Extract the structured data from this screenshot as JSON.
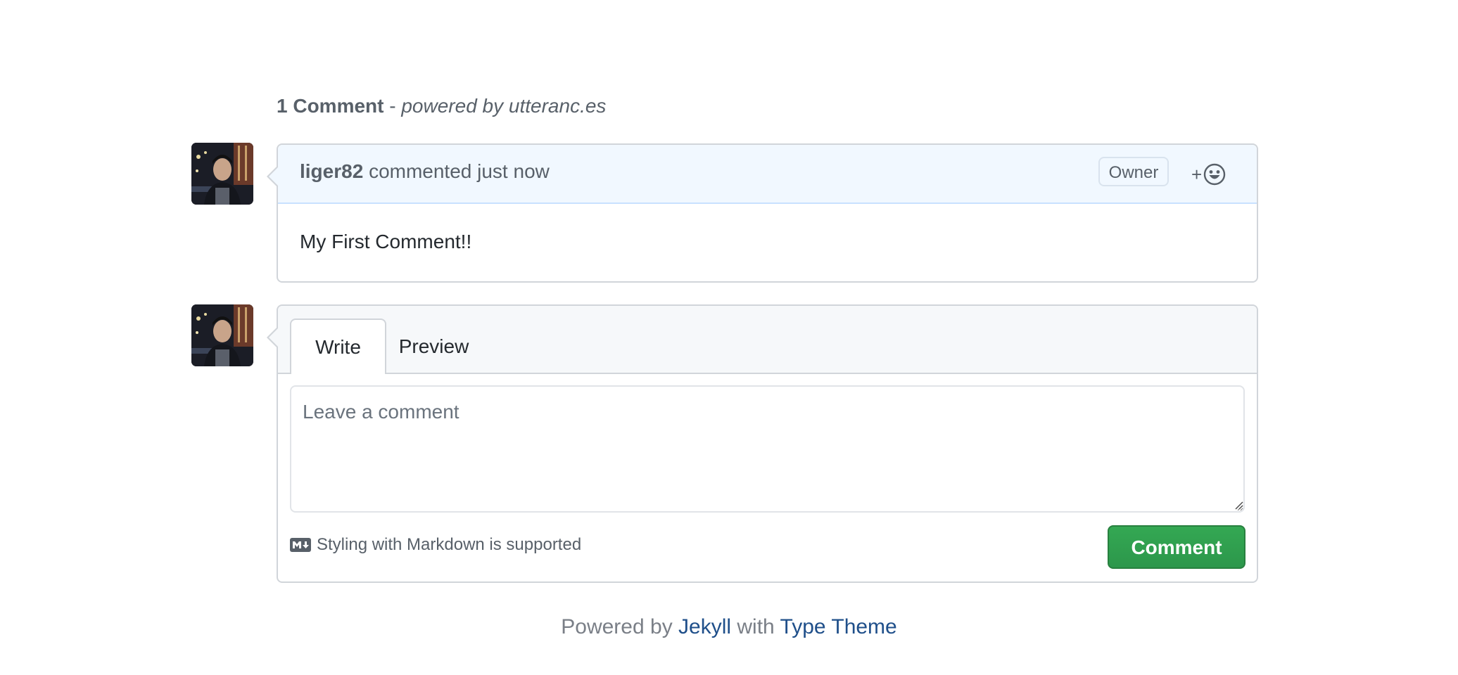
{
  "header": {
    "count_label": "1 Comment",
    "separator": " - ",
    "powered_label": "powered by utteranc.es"
  },
  "comments": [
    {
      "author": "liger82",
      "action": "commented",
      "time": "just now",
      "badge": "Owner",
      "body": "My First Comment!!",
      "reaction_plus": "+",
      "reaction_icon": "smiley-icon",
      "avatar_icon": "user-photo-avatar"
    }
  ],
  "editor": {
    "tabs": [
      {
        "label": "Write",
        "active": true
      },
      {
        "label": "Preview",
        "active": false
      }
    ],
    "placeholder": "Leave a comment",
    "value": "",
    "markdown_hint": "Styling with Markdown is supported",
    "markdown_icon": "markdown-icon",
    "submit_label": "Comment"
  },
  "footer": {
    "prefix": "Powered by ",
    "link1": "Jekyll",
    "middle": " with ",
    "link2": "Type Theme"
  },
  "colors": {
    "header_bg": "#f1f8ff",
    "submit_green": "#2ea44f",
    "footer_link": "#1f4f8a"
  }
}
